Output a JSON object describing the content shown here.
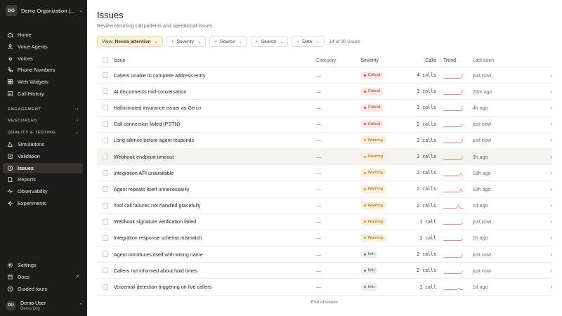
{
  "sidebar": {
    "org": {
      "initials": "DO",
      "name": "Demo Organization (..."
    },
    "nav_top": [
      {
        "label": "Home",
        "icon": "home-icon"
      },
      {
        "label": "Voice Agents",
        "icon": "voice-agent-icon"
      },
      {
        "label": "Voices",
        "icon": "voices-icon"
      },
      {
        "label": "Phone Numbers",
        "icon": "phone-icon"
      },
      {
        "label": "Web Widgets",
        "icon": "widget-icon"
      },
      {
        "label": "Call History",
        "icon": "history-icon"
      }
    ],
    "sections": {
      "engagement": "ENGAGEMENT",
      "resources": "RESOURCES",
      "quality": "QUALITY & TESTING"
    },
    "nav_quality": [
      {
        "label": "Simulations",
        "icon": "flask-icon"
      },
      {
        "label": "Validation",
        "icon": "validation-icon"
      },
      {
        "label": "Issues",
        "icon": "issues-icon",
        "active": true
      },
      {
        "label": "Reports",
        "icon": "reports-icon"
      },
      {
        "label": "Observability",
        "icon": "activity-icon"
      },
      {
        "label": "Experiments",
        "icon": "experiments-icon"
      }
    ],
    "nav_bottom": [
      {
        "label": "Settings",
        "icon": "gear-icon"
      },
      {
        "label": "Docs",
        "icon": "docs-icon"
      },
      {
        "label": "Guided tours",
        "icon": "tours-icon"
      }
    ],
    "user": {
      "initials": "DU",
      "name": "Demo User",
      "org": "Demo Org"
    }
  },
  "page": {
    "title": "Issues",
    "subtitle": "Review recurring call patterns and operational issues."
  },
  "filters": {
    "view_prefix": "View:",
    "view_value": "Needs attention",
    "severity": "Severity",
    "source": "Source",
    "search": "Search",
    "date": "Date",
    "count_text": "14 of 30 issues"
  },
  "table": {
    "headers": {
      "issue": "Issue",
      "category": "Category",
      "severity": "Severity",
      "calls": "Calls",
      "trend": "Trend",
      "last_seen": "Last seen"
    },
    "rows": [
      {
        "issue": "Callers unable to complete address entry",
        "category": "—",
        "severity": "Critical",
        "calls": "4 calls",
        "last_seen": "just now",
        "trend": [
          0,
          0,
          0,
          0,
          0,
          0,
          0,
          0,
          0,
          3
        ]
      },
      {
        "issue": "AI disconnects mid-conversation",
        "category": "—",
        "severity": "Critical",
        "calls": "3 calls",
        "last_seen": "20m ago",
        "trend": [
          0,
          0,
          0,
          0,
          0,
          0,
          0,
          0,
          0,
          3
        ]
      },
      {
        "issue": "Hallucinated insurance issuer as Geico",
        "category": "—",
        "severity": "Critical",
        "calls": "3 calls",
        "last_seen": "4h ago",
        "trend": [
          0,
          0,
          0,
          0,
          0,
          0,
          0,
          0,
          0,
          3
        ]
      },
      {
        "issue": "Call connection failed (PSTN)",
        "category": "—",
        "severity": "Critical",
        "calls": "2 calls",
        "last_seen": "just now",
        "trend": [
          0,
          0,
          0,
          0,
          0,
          0,
          0,
          0,
          0,
          2
        ]
      },
      {
        "issue": "Long silence before agent responds",
        "category": "—",
        "severity": "Warning",
        "calls": "3 calls",
        "last_seen": "just now",
        "trend": [
          0,
          0,
          0,
          0,
          0,
          0,
          0,
          0,
          0,
          3
        ]
      },
      {
        "issue": "Webhook endpoint timeout",
        "category": "—",
        "severity": "Warning",
        "calls": "2 calls",
        "last_seen": "3h ago",
        "trend": [
          0,
          0,
          0,
          0,
          0,
          0,
          0,
          0,
          0,
          2
        ]
      },
      {
        "issue": "Integration API unavailable",
        "category": "—",
        "severity": "Warning",
        "calls": "2 calls",
        "last_seen": "18h ago",
        "trend": [
          0,
          0,
          0,
          0,
          0,
          0,
          0,
          0,
          2,
          0
        ]
      },
      {
        "issue": "Agent repeats itself unnecessarily",
        "category": "—",
        "severity": "Warning",
        "calls": "2 calls",
        "last_seen": "19h ago",
        "trend": [
          0,
          0,
          0,
          0,
          0,
          0,
          0,
          0,
          2,
          0
        ]
      },
      {
        "issue": "Tool call failures not handled gracefully",
        "category": "—",
        "severity": "Warning",
        "calls": "2 calls",
        "last_seen": "1d ago",
        "trend": [
          0,
          0,
          0,
          0,
          0,
          0,
          0,
          2,
          0,
          0
        ]
      },
      {
        "issue": "Webhook signature verification failed",
        "category": "—",
        "severity": "Warning",
        "calls": "1 call",
        "last_seen": "just now",
        "trend": [
          0,
          0,
          0,
          0,
          0,
          0,
          0,
          0,
          0,
          1
        ]
      },
      {
        "issue": "Integration response schema mismatch",
        "category": "—",
        "severity": "Warning",
        "calls": "1 call",
        "last_seen": "1h ago",
        "trend": [
          0,
          0,
          0,
          0,
          0,
          0,
          0,
          0,
          0,
          1
        ]
      },
      {
        "issue": "Agent introduces itself with wrong name",
        "category": "—",
        "severity": "Info",
        "calls": "2 calls",
        "last_seen": "just now",
        "trend": [
          0,
          0,
          0,
          0,
          0,
          0,
          0,
          0,
          0,
          2
        ]
      },
      {
        "issue": "Callers not informed about hold times",
        "category": "—",
        "severity": "Info",
        "calls": "2 calls",
        "last_seen": "just now",
        "trend": [
          0,
          0,
          0,
          0,
          0,
          0,
          0,
          0,
          0,
          2
        ]
      },
      {
        "issue": "Voicemail detection triggering on live callers",
        "category": "—",
        "severity": "Info",
        "calls": "1 call",
        "last_seen": "1d ago",
        "trend": [
          0,
          0,
          0,
          0,
          0,
          0,
          0,
          1,
          0,
          0
        ]
      }
    ],
    "highlight_index": 5,
    "end_text": "End of issues"
  },
  "colors": {
    "sidebar_bg": "#1c1c1a",
    "trend_line": "#f08a80",
    "critical": "#d5453a",
    "warning": "#d99b2b",
    "info": "#7d7b74",
    "view_chip_bg": "#fbf3dc"
  }
}
